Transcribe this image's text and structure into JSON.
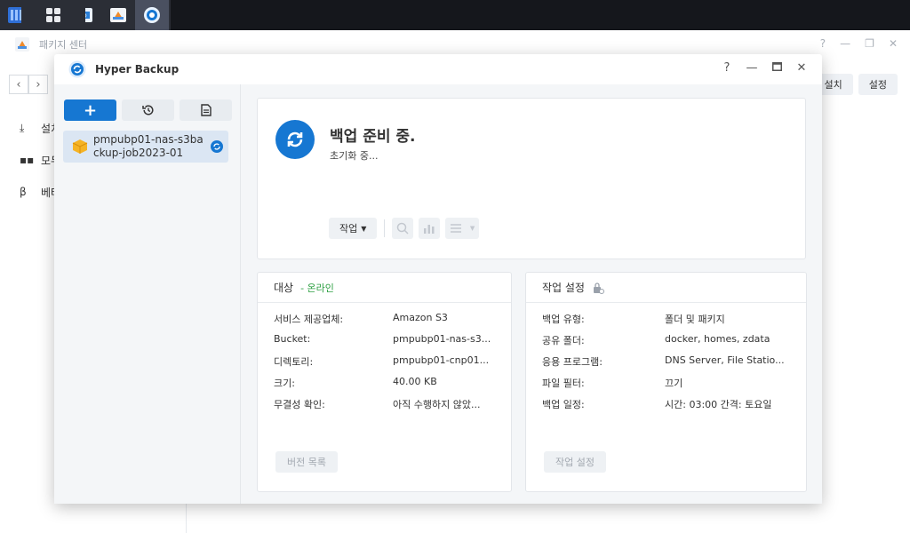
{
  "background_window": {
    "title": "패키지 센터",
    "sidebar": [
      {
        "label": "설치",
        "icon": "download-icon"
      },
      {
        "label": "모두",
        "icon": "grid-icon"
      },
      {
        "label": "베타",
        "icon": "beta-icon"
      }
    ],
    "top_buttons": [
      "설치",
      "설정"
    ]
  },
  "window": {
    "title": "Hyper Backup",
    "help": "?"
  },
  "task_list": [
    {
      "name": "pmpubp01-nas-s3backup-job2023-01",
      "status_icon": "sync-icon"
    }
  ],
  "status": {
    "title": "백업 준비 중.",
    "subtitle": "초기화 중...",
    "action_button": "작업"
  },
  "target": {
    "header": "대상",
    "state": "- 온라인",
    "rows": [
      {
        "key": "서비스 제공업체:",
        "value": "Amazon S3"
      },
      {
        "key": "Bucket:",
        "value": "pmpubp01-nas-s3..."
      },
      {
        "key": "디렉토리:",
        "value": "pmpubp01-cnp01..."
      },
      {
        "key": "크기:",
        "value": "40.00 KB"
      },
      {
        "key": "무결성 확인:",
        "value": "아직 수행하지 않았..."
      }
    ],
    "button": "버전 목록"
  },
  "settings": {
    "header": "작업 설정",
    "rows": [
      {
        "key": "백업 유형:",
        "value": "폴더 및 패키지"
      },
      {
        "key": "공유 폴더:",
        "value": "docker, homes, zdata"
      },
      {
        "key": "응용 프로그램:",
        "value": "DNS Server, File Statio..."
      },
      {
        "key": "파일 필터:",
        "value": "끄기"
      },
      {
        "key": "백업 일정:",
        "value": "시간: 03:00 간격: 토요일"
      }
    ],
    "button": "작업 설정"
  },
  "colors": {
    "accent": "#1677d2",
    "online": "#2ea043",
    "taskbar": "#15171c"
  }
}
